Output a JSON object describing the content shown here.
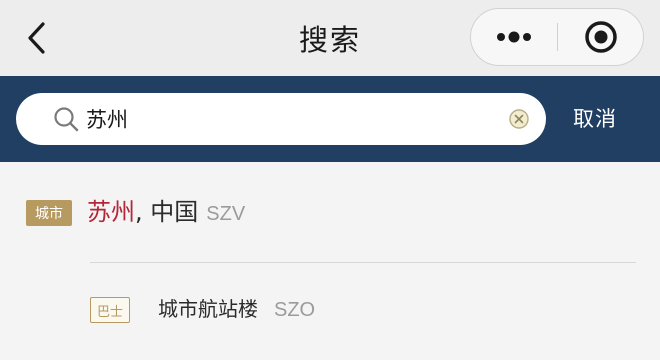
{
  "titlebar": {
    "title": "搜索",
    "back_icon": "chevron-left-icon",
    "more_icon": "more-dots-icon",
    "close_icon": "target-circle-icon"
  },
  "search": {
    "query": "苏州",
    "placeholder": "",
    "cancel_label": "取消",
    "band_color": "#203f63"
  },
  "results": [
    {
      "type_label": "城市",
      "highlight": "苏州",
      "rest": ", 中国",
      "code": "SZV"
    },
    {
      "type_label": "巴士",
      "name": "城市航站楼",
      "code": "SZO"
    }
  ],
  "colors": {
    "accent_gold": "#b79a60",
    "highlight_red": "#b3273a"
  }
}
